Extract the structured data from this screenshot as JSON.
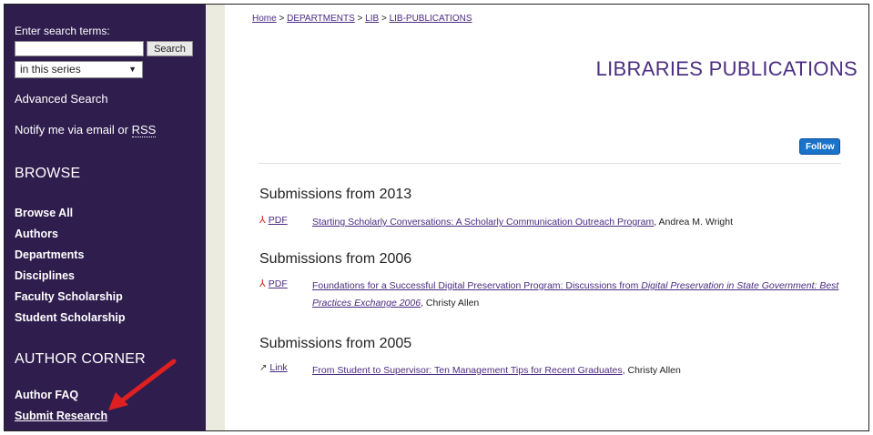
{
  "sidebar": {
    "search_label": "Enter search terms:",
    "search_input_value": "",
    "search_button": "Search",
    "scope_selected": "in this series",
    "advanced_search": "Advanced Search",
    "notify_prefix": "Notify me via email or ",
    "notify_rss": "RSS",
    "browse_heading": "BROWSE",
    "browse_items": [
      "Browse All",
      "Authors",
      "Departments",
      "Disciplines",
      "Faculty Scholarship",
      "Student Scholarship"
    ],
    "author_heading": "AUTHOR CORNER",
    "author_items": [
      "Author FAQ",
      "Submit Research"
    ]
  },
  "breadcrumb": {
    "items": [
      "Home",
      "DEPARTMENTS",
      "LIB",
      "LIB-PUBLICATIONS"
    ],
    "separator": ">"
  },
  "page_title": "LIBRARIES PUBLICATIONS",
  "follow_button": "Follow",
  "sections": [
    {
      "heading": "Submissions from 2013",
      "entries": [
        {
          "type": "PDF",
          "icon": "pdf-icon",
          "title": "Starting Scholarly Conversations: A Scholarly Communication Outreach Program",
          "author": ", Andrea M. Wright"
        }
      ]
    },
    {
      "heading": "Submissions from 2006",
      "entries": [
        {
          "type": "PDF",
          "icon": "pdf-icon",
          "title_part1": "Foundations for a Successful Digital Preservation Program: Discussions from ",
          "title_italic": "Digital Preservation in State Government: Best Practices Exchange 2006",
          "author": ", Christy Allen"
        }
      ]
    },
    {
      "heading": "Submissions from 2005",
      "entries": [
        {
          "type": "Link",
          "icon": "external-link-icon",
          "title": "From Student to Supervisor: Ten Management Tips for Recent Graduates",
          "author": ", Christy Allen"
        }
      ]
    }
  ],
  "colors": {
    "sidebar_bg": "#2f1d4e",
    "title": "#4b2e83",
    "link": "#4a2a80",
    "follow_bg": "#1a73c9",
    "annotation_arrow": "#e02020"
  }
}
